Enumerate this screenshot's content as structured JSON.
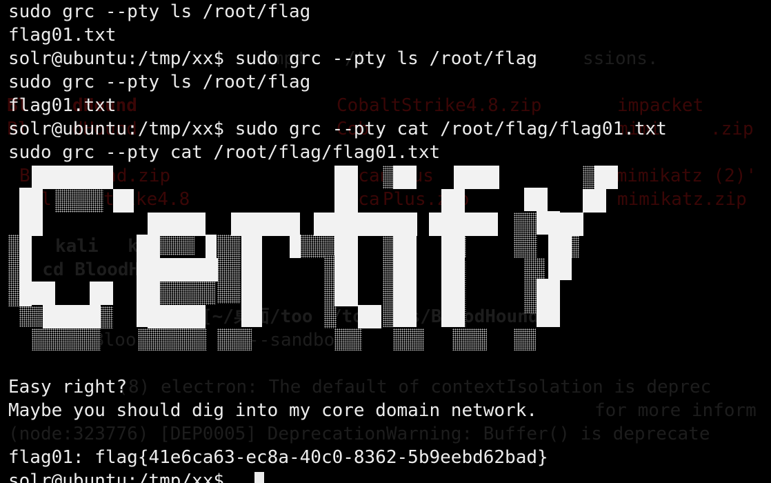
{
  "terminal": {
    "lines": [
      "sudo grc --pty ls /root/flag",
      "flag01.txt",
      "solr@ubuntu:/tmp/xx$ sudo grc --pty ls /root/flag",
      "sudo grc --pty ls /root/flag",
      "flag01.txt",
      "solr@ubuntu:/tmp/xx$ sudo grc --pty cat /root/flag/flag01.txt",
      "sudo grc --pty cat /root/flag/flag01.txt"
    ],
    "message_lines": [
      "Easy right?",
      "Maybe you should dig into my core domain network."
    ],
    "flag_line": "flag01: flag{41e6ca63-ec8a-40c0-8362-5b9eebd62bad}",
    "prompt": "solr@ubuntu:/tmp/xx$ ",
    "banner_text": "Certify",
    "text_color": "#ececec",
    "background_color": "#000000",
    "ghost_red_color": "#3a0606"
  },
  "ghost": {
    "items": [
      "imp",
      "t ",
      "/t",
      "ssions.",
      "Bl",
      "dHound",
      "CobaltStrike4.8.zip",
      "impacket",
      "Bl",
      "dHound",
      "Cob",
      "mimi",
      ".zip",
      "BloodHound.zip",
      "FscanPlus",
      "'mimikatz (2)'",
      "Col",
      "trike4.8",
      "Fsca",
      "Plus.zip",
      "mimikatz.zip",
      "kali",
      "kal",
      "s/",
      "ls",
      "$ cd BloodHound",
      "kali",
      "1)-[~/桌面/too",
      "/to",
      "ls/BloodHound]",
      "Bloo",
      "--sandbox",
      "(",
      "8) electron: The default of contextIsolation is deprec",
      "(node:323776) [DEP0005] DeprecationWarning: Buffer() is deprecate",
      "for more inform"
    ]
  }
}
